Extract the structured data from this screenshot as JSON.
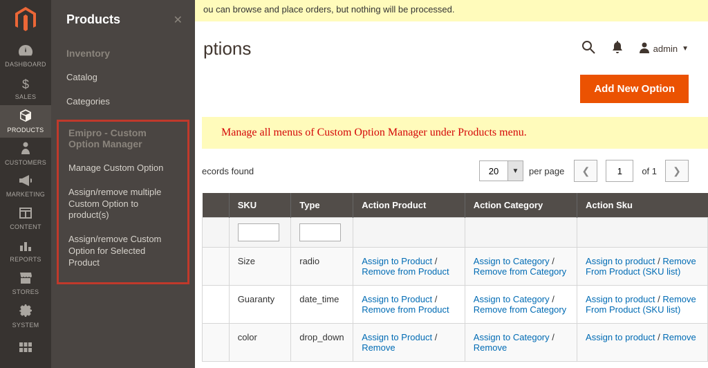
{
  "sidebar": {
    "items": [
      {
        "label": "DASHBOARD"
      },
      {
        "label": "SALES"
      },
      {
        "label": "PRODUCTS"
      },
      {
        "label": "CUSTOMERS"
      },
      {
        "label": "MARKETING"
      },
      {
        "label": "CONTENT"
      },
      {
        "label": "REPORTS"
      },
      {
        "label": "STORES"
      },
      {
        "label": "SYSTEM"
      }
    ]
  },
  "flyout": {
    "title": "Products",
    "inventory_header": "Inventory",
    "catalog": "Catalog",
    "categories": "Categories",
    "group_header": "Emipro - Custom Option Manager",
    "manage": "Manage Custom Option",
    "assign_multi": "Assign/remove multiple Custom Option to product(s)",
    "assign_selected": "Assign/remove Custom Option for Selected Product"
  },
  "demo_banner": "ou can browse and place orders, but nothing will be processed.",
  "page_title": "ptions",
  "user": {
    "name": "admin"
  },
  "add_button": "Add New Option",
  "callout": "Manage all menus of Custom Option Manager under Products menu.",
  "records": {
    "found": "ecords found",
    "per_page_value": "20",
    "per_page_label": "per page",
    "page_value": "1",
    "of_label": "of 1"
  },
  "grid": {
    "headers": {
      "sku": "SKU",
      "type": "Type",
      "action_product": "Action Product",
      "action_category": "Action Category",
      "action_sku": "Action Sku"
    },
    "link_product_assign": "Assign to Product",
    "link_product_remove": "Remove from Product",
    "link_category_assign": "Assign to Category",
    "link_category_remove": "Remove from Category",
    "link_sku_assign": "Assign to product",
    "link_sku_remove": "Remove From Product (SKU list)",
    "link_product_assign_short": "Assign to Product",
    "link_remove_short": "Remove",
    "rows": [
      {
        "sku": "Size",
        "type": "radio"
      },
      {
        "sku": "Guaranty",
        "type": "date_time"
      },
      {
        "sku": "color",
        "type": "drop_down"
      }
    ]
  }
}
